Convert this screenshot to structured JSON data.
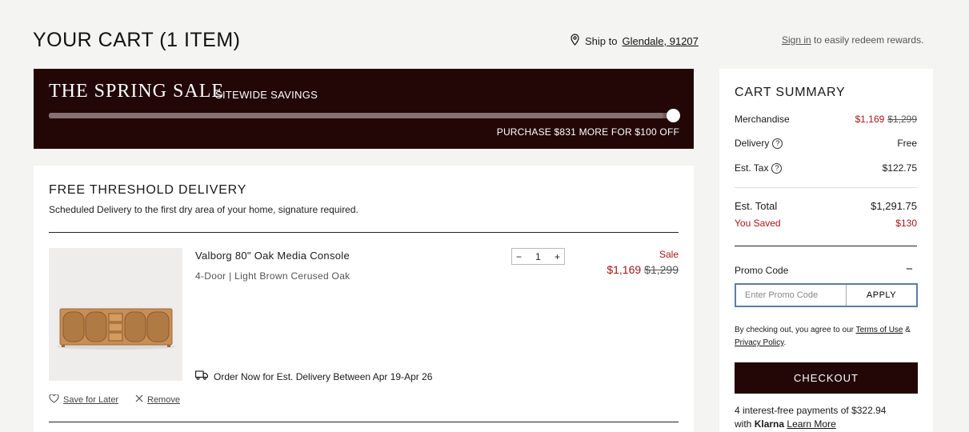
{
  "header": {
    "title": "YOUR CART (1 ITEM)",
    "ship_label": "Ship to",
    "ship_location": "Glendale, 91207",
    "signin_link": "Sign in",
    "signin_text": "to easily redeem rewards."
  },
  "sale_banner": {
    "title": "THE SPRING SALE",
    "subtitle": "SITEWIDE SAVINGS",
    "progress_fraction": 0.985,
    "message": "PURCHASE $831 MORE FOR $100 OFF"
  },
  "delivery": {
    "title": "FREE THRESHOLD DELIVERY",
    "description": "Scheduled Delivery to the first dry area of your home, signature required."
  },
  "item": {
    "name": "Valborg 80\" Oak Media Console",
    "variant": "4-Door | Light Brown Cerused Oak",
    "quantity": "1",
    "minus": "−",
    "plus": "+",
    "sale_label": "Sale",
    "price_now": "$1,169",
    "price_was": "$1,299",
    "est_delivery": "Order Now for Est. Delivery Between Apr 19-Apr 26",
    "save_for_later": "Save for Later",
    "remove": "Remove"
  },
  "summary": {
    "title": "CART SUMMARY",
    "merchandise_label": "Merchandise",
    "merchandise_now": "$1,169",
    "merchandise_was": "$1,299",
    "delivery_label": "Delivery",
    "delivery_value": "Free",
    "tax_label": "Est. Tax",
    "tax_value": "$122.75",
    "help_glyph": "?",
    "total_label": "Est. Total",
    "total_value": "$1,291.75",
    "saved_label": "You Saved",
    "saved_value": "$130",
    "promo_label": "Promo Code",
    "promo_toggle": "−",
    "promo_placeholder": "Enter Promo Code",
    "apply_label": "APPLY",
    "terms_prefix": "By checking out, you agree to our",
    "terms_link": "Terms of Use",
    "terms_and": "&",
    "privacy_link": "Privacy Policy",
    "terms_suffix": ".",
    "checkout_label": "CHECKOUT",
    "klarna_prefix": "4 interest-free payments of $322.94",
    "klarna_with": "with",
    "klarna_logo": "Klarna",
    "klarna_link": "Learn More"
  },
  "colors": {
    "brand_dark": "#230707",
    "sale_red": "#a31818",
    "focus_blue": "#5b7ca2"
  },
  "icons": [
    "location-pin-icon",
    "delivery-truck-icon",
    "heart-icon",
    "close-icon",
    "help-icon",
    "minus-icon"
  ]
}
